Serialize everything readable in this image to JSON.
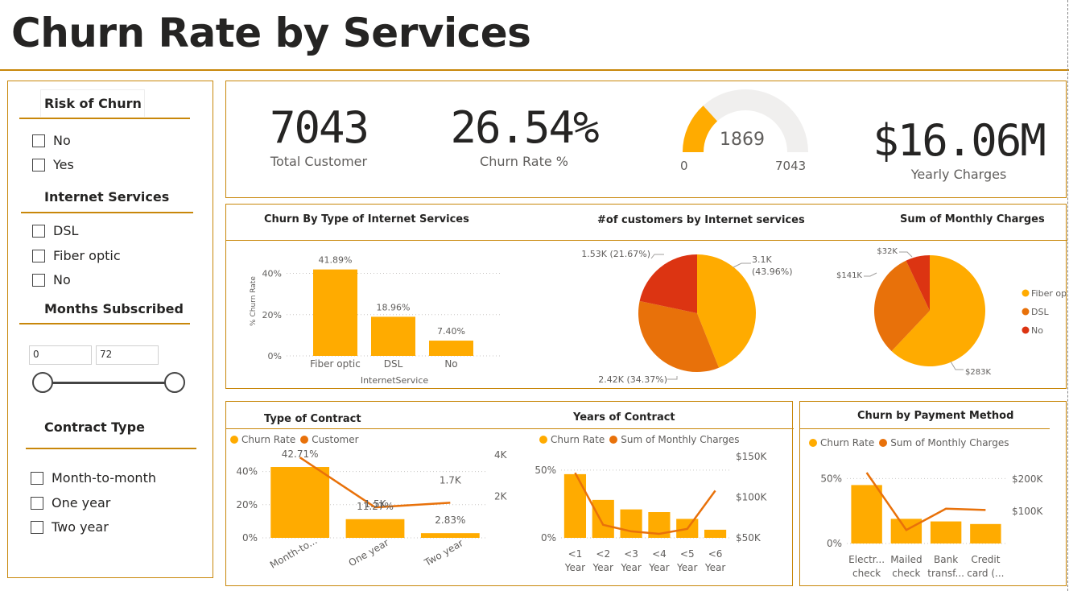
{
  "header": {
    "title": "Churn Rate by Services"
  },
  "colors": {
    "accent": "#c8870a",
    "fiber": "#ffab00",
    "dsl": "#e8710a",
    "no": "#dc3412"
  },
  "filters": {
    "risk": {
      "title": "Risk of Churn",
      "items": [
        "No",
        "Yes"
      ]
    },
    "internet": {
      "title": "Internet Services",
      "items": [
        "DSL",
        "Fiber optic",
        "No"
      ]
    },
    "months": {
      "title": "Months Subscribed",
      "min": "0",
      "max": "72"
    },
    "contract": {
      "title": "Contract Type",
      "items": [
        "Month-to-month",
        "One year",
        "Two year"
      ]
    }
  },
  "kpis": {
    "total_customer": {
      "value": "7043",
      "label": "Total Customer"
    },
    "churn_rate": {
      "value": "26.54%",
      "label": "Churn Rate %"
    },
    "gauge": {
      "value": "1869",
      "min_label": "0",
      "max_label": "7043",
      "current": 1869,
      "max": 7043
    },
    "yearly_charges": {
      "value": "$16.06M",
      "label": "Yearly Charges"
    }
  },
  "chart_data": [
    {
      "id": "churn_by_internet",
      "type": "bar",
      "title": "Churn By Type of Internet Services",
      "xlabel": "InternetService",
      "ylabel": "% Churn Rate",
      "categories": [
        "Fiber optic",
        "DSL",
        "No"
      ],
      "values": [
        41.89,
        18.96,
        7.4
      ],
      "data_labels": [
        "41.89%",
        "18.96%",
        "7.40%"
      ],
      "yticks": [
        "0%",
        "20%",
        "40%"
      ],
      "ylim": [
        0,
        48
      ]
    },
    {
      "id": "customers_by_internet",
      "type": "pie",
      "title": "#of customers by Internet services",
      "slices": [
        {
          "name": "Fiber optic",
          "value": 3096,
          "label": "3.1K",
          "pct": "(43.96%)"
        },
        {
          "name": "DSL",
          "value": 2421,
          "label": "2.42K (34.37%)",
          "pct": ""
        },
        {
          "name": "No",
          "value": 1526,
          "label": "1.53K (21.67%)",
          "pct": ""
        }
      ]
    },
    {
      "id": "monthly_charges",
      "type": "pie",
      "title": "Sum of Monthly Charges",
      "slices": [
        {
          "name": "Fiber optic",
          "value": 283,
          "label": "$283K"
        },
        {
          "name": "DSL",
          "value": 141,
          "label": "$141K"
        },
        {
          "name": "No",
          "value": 32,
          "label": "$32K"
        }
      ],
      "legend": [
        "Fiber optic",
        "DSL",
        "No"
      ]
    },
    {
      "id": "type_of_contract",
      "type": "bar",
      "title": "Type of Contract",
      "legend": [
        "Churn Rate",
        "Customer"
      ],
      "categories": [
        "Month-to...",
        "One year",
        "Two year"
      ],
      "series": [
        {
          "name": "Churn Rate",
          "values": [
            42.71,
            11.27,
            2.83
          ],
          "labels": [
            "42.71%",
            "11.27%",
            "2.83%"
          ]
        },
        {
          "name": "Customer",
          "values": [
            3875,
            1473,
            1695
          ],
          "labels": [
            "",
            "1.5K",
            "1.7K"
          ]
        }
      ],
      "yticks_left": [
        "0%",
        "20%",
        "40%"
      ],
      "yticks_right": [
        "2K",
        "4K"
      ],
      "ylim": [
        0,
        50
      ],
      "y2lim": [
        0,
        4000
      ]
    },
    {
      "id": "years_of_contract",
      "type": "bar",
      "title": "Years of Contract",
      "legend": [
        "Churn Rate",
        "Sum of Monthly Charges"
      ],
      "categories": [
        [
          "<1",
          "Year"
        ],
        [
          "<2",
          "Year"
        ],
        [
          "<3",
          "Year"
        ],
        [
          "<4",
          "Year"
        ],
        [
          "<5",
          "Year"
        ],
        [
          "<6",
          "Year"
        ]
      ],
      "series": [
        {
          "name": "Churn Rate",
          "values": [
            47,
            28,
            21,
            19,
            14,
            6
          ]
        },
        {
          "name": "Sum of Monthly Charges",
          "values": [
            130,
            66,
            58,
            55,
            61,
            108
          ]
        }
      ],
      "yticks_left": [
        "0%",
        "50%"
      ],
      "yticks_right": [
        "$50K",
        "$100K",
        "$150K"
      ],
      "ylim": [
        0,
        60
      ],
      "y2lim": [
        50,
        150
      ]
    },
    {
      "id": "payment_method",
      "type": "bar",
      "title": "Churn by Payment Method",
      "legend": [
        "Churn Rate",
        "Sum of Monthly Charges"
      ],
      "categories": [
        [
          "Electr...",
          "check"
        ],
        [
          "Mailed",
          "check"
        ],
        [
          "Bank",
          "transf..."
        ],
        [
          "Credit",
          "card (..."
        ]
      ],
      "series": [
        {
          "name": "Churn Rate",
          "values": [
            45,
            19,
            17,
            15
          ]
        },
        {
          "name": "Sum of Monthly Charges",
          "values": [
            220,
            42,
            108,
            104
          ]
        }
      ],
      "yticks_left": [
        "0%",
        "50%"
      ],
      "yticks_right": [
        "$100K",
        "$200K"
      ],
      "ylim": [
        0,
        62
      ],
      "y2lim": [
        0,
        250
      ]
    }
  ]
}
